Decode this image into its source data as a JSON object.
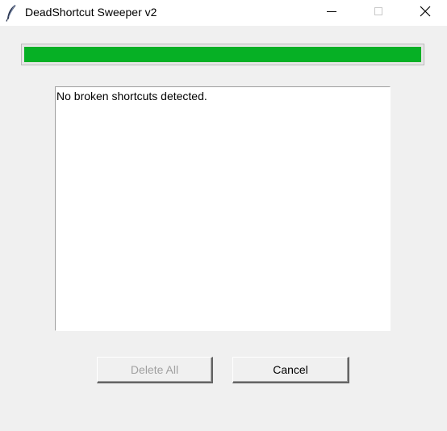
{
  "window": {
    "title": "DeadShortcut Sweeper v2",
    "app_icon": "feather-icon",
    "controls": [
      "minimize-icon",
      "maximize-icon",
      "close-icon"
    ]
  },
  "progress": {
    "fraction": 1.0,
    "color": "#06b025"
  },
  "results": {
    "lines": [
      "No broken shortcuts detected."
    ]
  },
  "buttons": {
    "delete_all": {
      "label": "Delete All",
      "enabled": false
    },
    "cancel": {
      "label": "Cancel",
      "enabled": true
    }
  }
}
